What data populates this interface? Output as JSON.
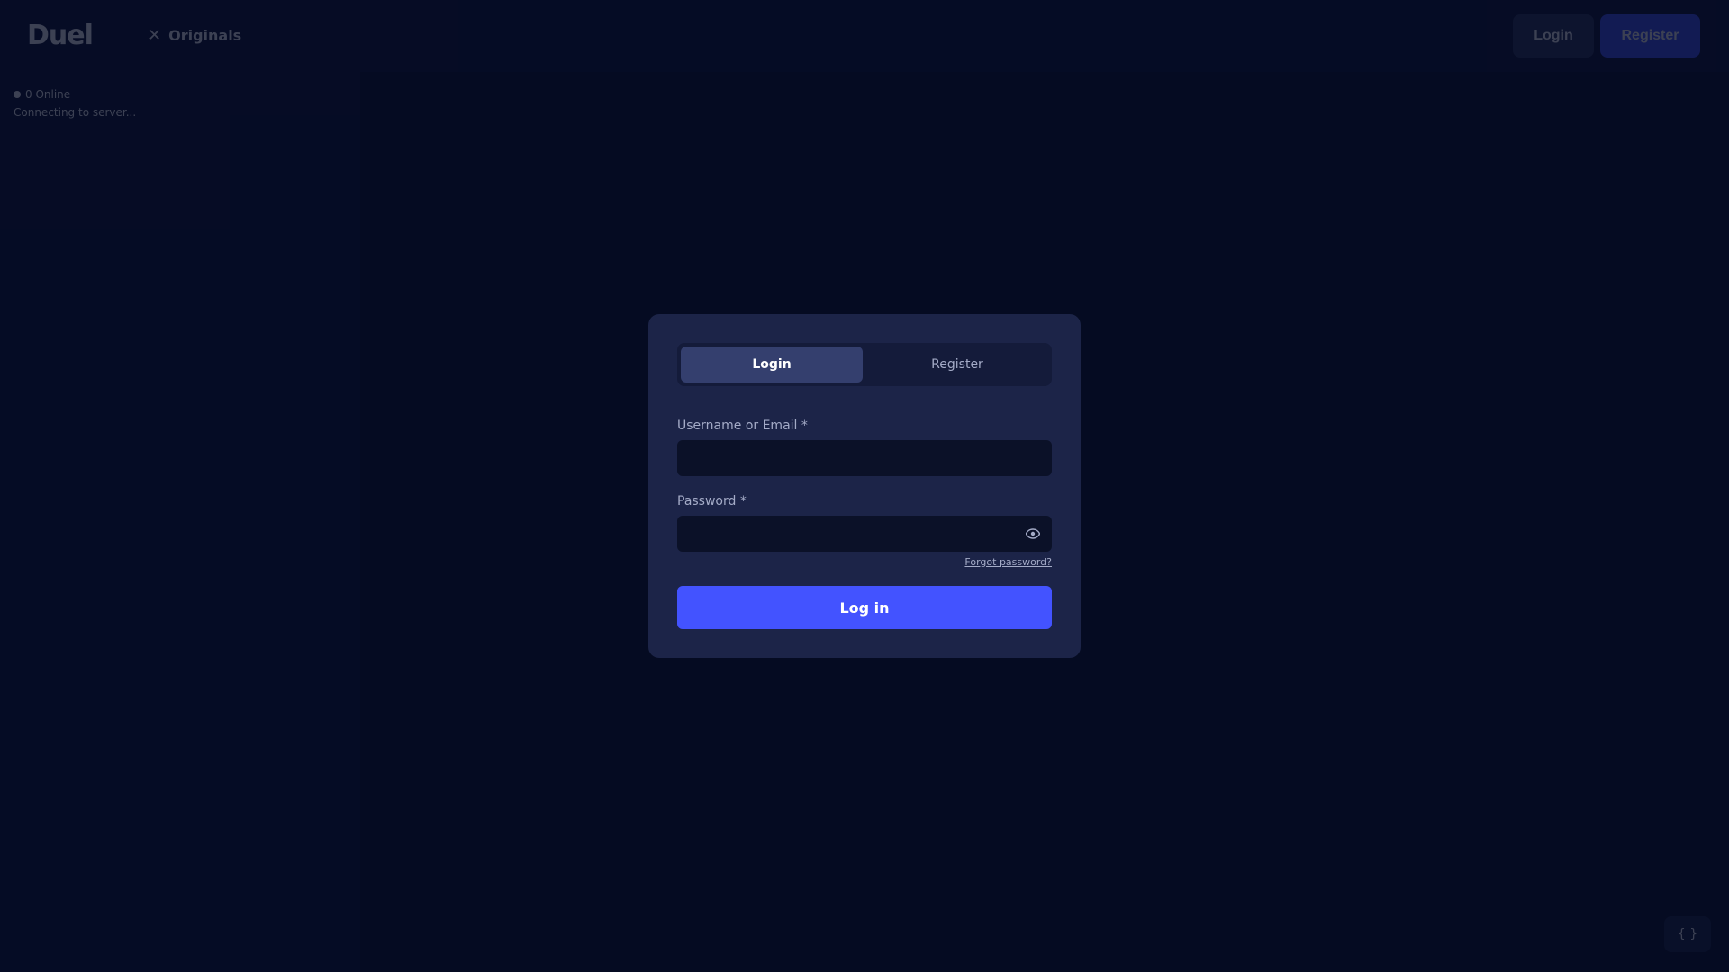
{
  "header": {
    "logo": "Duel",
    "nav": {
      "originals_label": "Originals",
      "originals_icon": "crossed-swords-icon"
    },
    "login_label": "Login",
    "register_label": "Register"
  },
  "sidebar": {
    "online_count": "0 Online",
    "connecting_text": "Connecting to server..."
  },
  "corner_widget": {
    "label": "{ }"
  },
  "modal": {
    "tabs": [
      {
        "label": "Login",
        "active": true
      },
      {
        "label": "Register",
        "active": false
      }
    ],
    "username": {
      "label": "Username or Email *",
      "value": "",
      "placeholder": ""
    },
    "password": {
      "label": "Password *",
      "value": "",
      "placeholder": "",
      "toggle_icon": "eye-icon"
    },
    "forgot_label": "Forgot password?",
    "submit_label": "Log in"
  },
  "colors": {
    "background": "#050b22",
    "modal": "#1c2448",
    "accent": "#4353ff",
    "muted_text": "#a4abc7"
  }
}
